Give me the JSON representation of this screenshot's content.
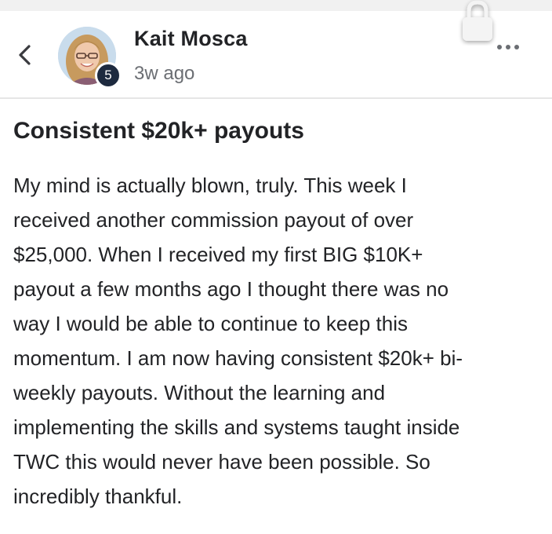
{
  "post": {
    "author_name": "Kait Mosca",
    "time_ago": "3w ago",
    "author_level": "5",
    "title": "Consistent $20k+ payouts",
    "body_lines": [
      "My mind is actually blown, truly. This week I",
      "received another commission payout of over",
      "$25,000. When I received my first BIG $10K+",
      "payout a few months ago I thought there was no",
      "way I would be able to continue to keep this",
      "momentum. I am now having consistent $20k+ bi-",
      "weekly payouts. Without the learning and",
      "implementing the skills and systems taught inside",
      "TWC this would never have been possible. So",
      "incredibly thankful."
    ]
  },
  "icons": {
    "back": "chevron-left-icon",
    "lock": "lock-icon",
    "more": "more-horizontal-icon"
  },
  "colors": {
    "text": "#222326",
    "muted": "#6b6e73",
    "badge": "#1d2a3f",
    "divider": "#e6e6e6"
  }
}
